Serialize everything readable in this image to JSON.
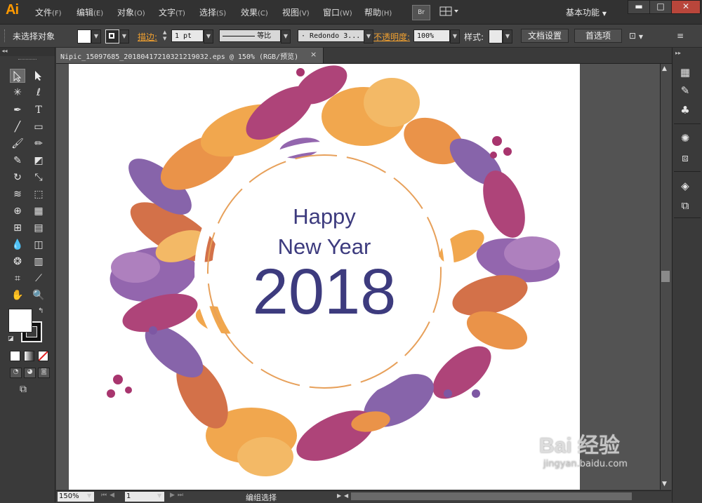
{
  "app": {
    "logo": "Ai"
  },
  "menu": [
    {
      "label": "文件",
      "key": "(F)"
    },
    {
      "label": "编辑",
      "key": "(E)"
    },
    {
      "label": "对象",
      "key": "(O)"
    },
    {
      "label": "文字",
      "key": "(T)"
    },
    {
      "label": "选择",
      "key": "(S)"
    },
    {
      "label": "效果",
      "key": "(C)"
    },
    {
      "label": "视图",
      "key": "(V)"
    },
    {
      "label": "窗口",
      "key": "(W)"
    },
    {
      "label": "帮助",
      "key": "(H)"
    }
  ],
  "bridge_label": "Br",
  "workspace": "基本功能",
  "window_controls": {
    "minimize": "▬",
    "maximize": "□",
    "close": "✕"
  },
  "control": {
    "selection": "未选择对象",
    "stroke_label": "描边:",
    "stroke_weight": "1 pt",
    "stroke_profile": "等比",
    "brush": "Redondo 3...",
    "opacity_label": "不透明度:",
    "opacity": "100%",
    "style_label": "样式:",
    "doc_setup": "文档设置",
    "preferences": "首选项"
  },
  "document_tab": {
    "title": "Nipic_15097685_20180417210321219032.eps @ 150% (RGB/预览)",
    "close": "×"
  },
  "artwork": {
    "line1": "Happy",
    "line2": "New Year",
    "line3": "2018",
    "colors": {
      "text": "#3d3b7e",
      "orange": "#f0a040",
      "purple": "#7d57a3",
      "magenta": "#a8356e",
      "rust": "#d0653a"
    }
  },
  "status": {
    "zoom": "150%",
    "page": "1",
    "text": "编组选择"
  },
  "watermark": {
    "brand": "Bai  经验",
    "url": "jingyan.baidu.com"
  }
}
